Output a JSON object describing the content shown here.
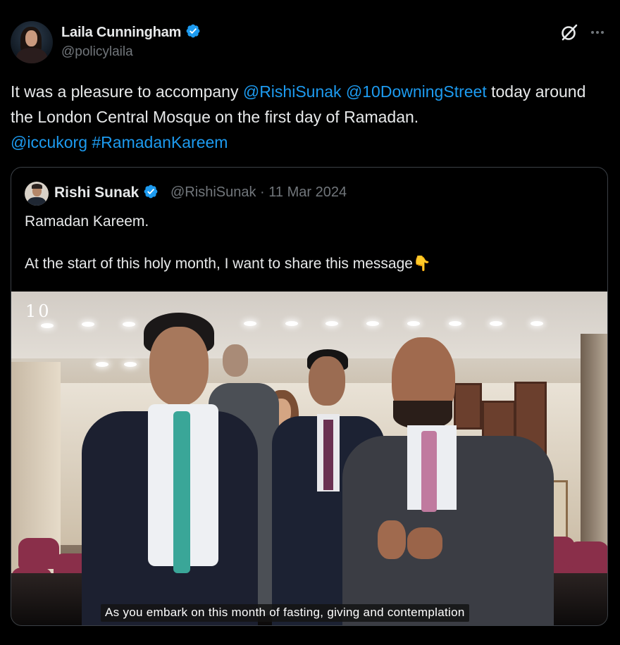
{
  "post": {
    "author": {
      "display_name": "Laila Cunningham",
      "handle": "@policylaila",
      "verified": true
    },
    "text": {
      "part1": "It was a pleasure to accompany ",
      "mention1": "@RishiSunak",
      "space1": " ",
      "mention2": "@10DowningStreet",
      "part2": " today around the London Central Mosque on the first day of Ramadan. ",
      "mention3": "@iccukorg",
      "space2": " ",
      "hashtag": "#RamadanKareem"
    },
    "icons": {
      "grok": "grok-icon",
      "more": "more-icon"
    },
    "colors": {
      "background": "#000000",
      "text": "#e7e9ea",
      "muted": "#71767b",
      "link": "#1d9bf0",
      "verified": "#1d9bf0",
      "border": "#3b4046"
    }
  },
  "quote": {
    "author": {
      "display_name": "Rishi Sunak",
      "handle": "@RishiSunak",
      "date": "11 Mar 2024",
      "separator": " · ",
      "verified": true
    },
    "line1": "Ramadan Kareem.",
    "line2": "At the start of this holy month, I want to share this message👇",
    "media": {
      "watermark": "10",
      "caption": "As you embark on this month of fasting, giving and contemplation"
    }
  }
}
